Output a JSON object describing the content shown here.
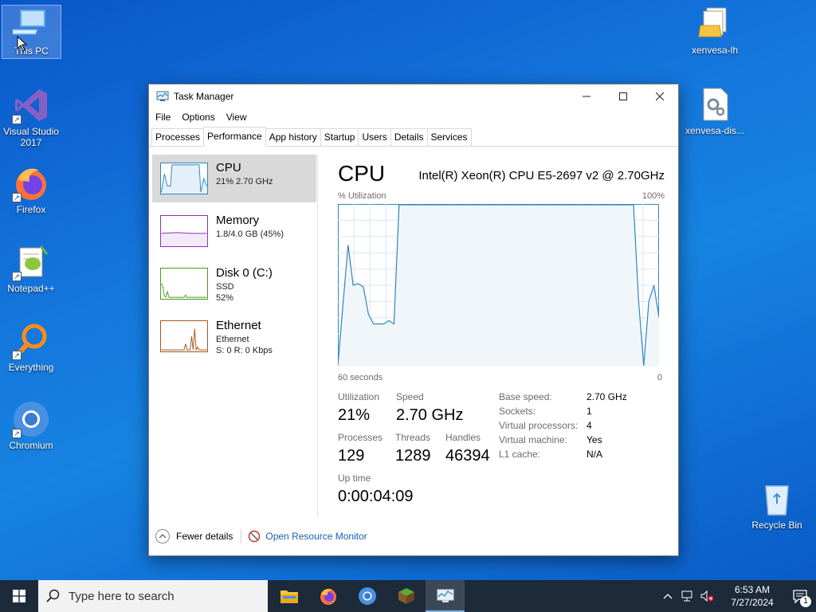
{
  "desktop": {
    "icons": [
      {
        "label": "This PC"
      },
      {
        "label": "Visual Studio 2017"
      },
      {
        "label": "Firefox"
      },
      {
        "label": "Notepad++"
      },
      {
        "label": "Everything"
      },
      {
        "label": "Chromium"
      },
      {
        "label": "xenvesa-lh"
      },
      {
        "label": "xenvesa-dis..."
      },
      {
        "label": "Recycle Bin"
      }
    ]
  },
  "window": {
    "title": "Task Manager",
    "menu": [
      "File",
      "Options",
      "View"
    ],
    "tabs": [
      "Processes",
      "Performance",
      "App history",
      "Startup",
      "Users",
      "Details",
      "Services"
    ],
    "active_tab": "Performance"
  },
  "sidebar": {
    "items": [
      {
        "name": "CPU",
        "line1": "21%  2.70 GHz",
        "line2": ""
      },
      {
        "name": "Memory",
        "line1": "1.8/4.0 GB (45%)",
        "line2": ""
      },
      {
        "name": "Disk 0 (C:)",
        "line1": "SSD",
        "line2": "52%"
      },
      {
        "name": "Ethernet",
        "line1": "Ethernet",
        "line2": "S: 0  R: 0 Kbps"
      }
    ]
  },
  "cpu": {
    "title": "CPU",
    "model": "Intel(R) Xeon(R) CPU E5-2697 v2 @ 2.70GHz",
    "graph": {
      "y_label": "% Utilization",
      "y_max_label": "100%",
      "x_left_label": "60 seconds",
      "x_right_label": "0",
      "utilization_series": [
        0,
        38,
        75,
        50,
        51,
        49,
        32,
        26,
        26,
        26,
        28,
        26,
        100,
        100,
        100,
        100,
        100,
        100,
        100,
        100,
        100,
        100,
        100,
        100,
        100,
        100,
        100,
        100,
        100,
        100,
        100,
        100,
        100,
        100,
        100,
        100,
        100,
        100,
        100,
        100,
        100,
        100,
        100,
        100,
        100,
        100,
        100,
        100,
        100,
        100,
        100,
        100,
        100,
        100,
        100,
        100,
        100,
        100,
        100,
        40,
        0,
        40,
        50,
        30
      ]
    },
    "stats": {
      "utilization_label": "Utilization",
      "utilization": "21%",
      "speed_label": "Speed",
      "speed": "2.70 GHz",
      "processes_label": "Processes",
      "processes": "129",
      "threads_label": "Threads",
      "threads": "1289",
      "handles_label": "Handles",
      "handles": "46394",
      "uptime_label": "Up time",
      "uptime": "0:00:04:09"
    },
    "details": [
      {
        "label": "Base speed:",
        "value": "2.70 GHz"
      },
      {
        "label": "Sockets:",
        "value": "1"
      },
      {
        "label": "Virtual processors:",
        "value": "4"
      },
      {
        "label": "Virtual machine:",
        "value": "Yes"
      },
      {
        "label": "L1 cache:",
        "value": "N/A"
      }
    ]
  },
  "footer": {
    "fewer_details": "Fewer details",
    "open_resource_monitor": "Open Resource Monitor"
  },
  "taskbar": {
    "search_placeholder": "Type here to search",
    "time": "6:53 AM",
    "date": "7/27/2024",
    "notification_count": "1"
  },
  "colors": {
    "cpu_line": "#2e86c1",
    "cpu_fill": "#f1f6fb",
    "memory_line": "#8b2fb0",
    "disk_line": "#4d9a1e",
    "ethernet_line": "#a6561a"
  }
}
